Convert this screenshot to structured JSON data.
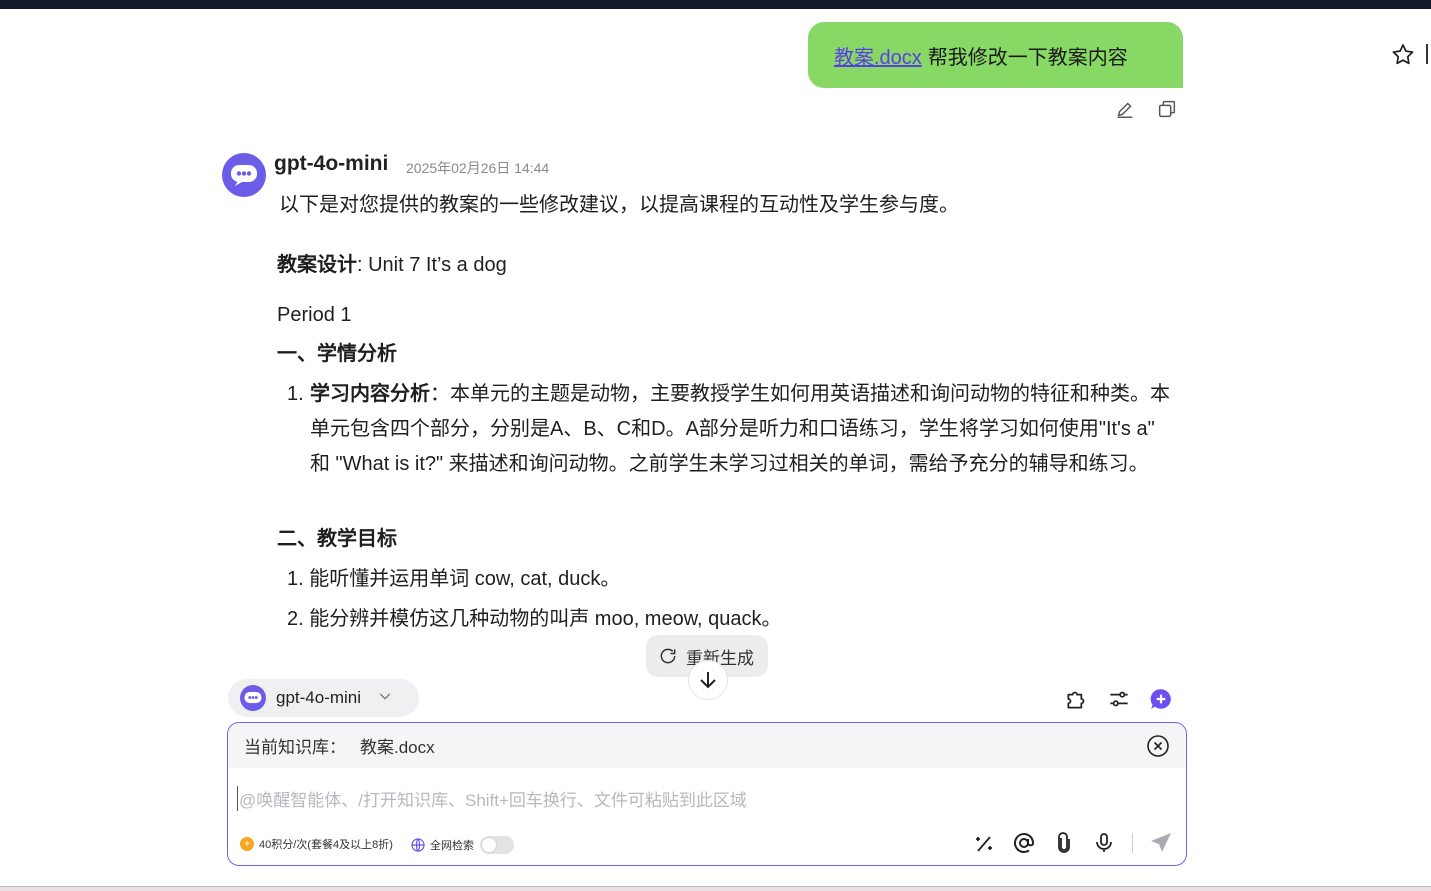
{
  "user_message": {
    "file_link": "教案.docx",
    "text": "帮我修改一下教案内容"
  },
  "response": {
    "model": "gpt-4o-mini",
    "timestamp": "2025年02月26日 14:44",
    "intro": "以下是对您提供的教案的一些修改建议，以提高课程的互动性及学生参与度。",
    "design_label": "教案设计",
    "design_value": ": Unit 7 It’s a dog",
    "period": "Period 1",
    "section1_title": "一、学情分析",
    "section1_item1_num": "1.",
    "section1_item1_label": "学习内容分析",
    "section1_item1_text": "：本单元的主题是动物，主要教授学生如何用英语描述和询问动物的特征和种类。本单元包含四个部分，分别是A、B、C和D。A部分是听力和口语练习，学生将学习如何使用\"It's a\" 和 \"What is it?\" 来描述和询问动物。之前学生未学习过相关的单词，需给予充分的辅导和练习。",
    "section2_title": "二、教学目标",
    "section2_items": [
      "1. 能听懂并运用单词 cow, cat, duck。",
      "2. 能分辨并模仿这几种动物的叫声 moo, meow, quack。"
    ]
  },
  "regenerate_label": "重新生成",
  "model_selector": "gpt-4o-mini",
  "composer": {
    "kb_label": "当前知识库：",
    "kb_file": "教案.docx",
    "placeholder": "@唤醒智能体、/打开知识库、Shift+回车换行、文件可粘贴到此区域",
    "credits": "40积分/次(套餐4及以上8折)",
    "web_search": "全网检索"
  },
  "icons": {
    "favorite": "star-icon",
    "edit": "pencil-icon",
    "copy": "copy-icon",
    "plugins": "puzzle-icon",
    "settings": "sliders-icon",
    "new_chat": "plus-chat-icon",
    "close": "close-circle-icon",
    "magic": "magic-wand-icon",
    "mention": "at-icon",
    "attach": "paperclip-icon",
    "voice": "microphone-icon",
    "send": "send-icon"
  },
  "colors": {
    "accent": "#6c5ce7",
    "user_bubble": "#88d865",
    "link": "#5b3fe6"
  }
}
